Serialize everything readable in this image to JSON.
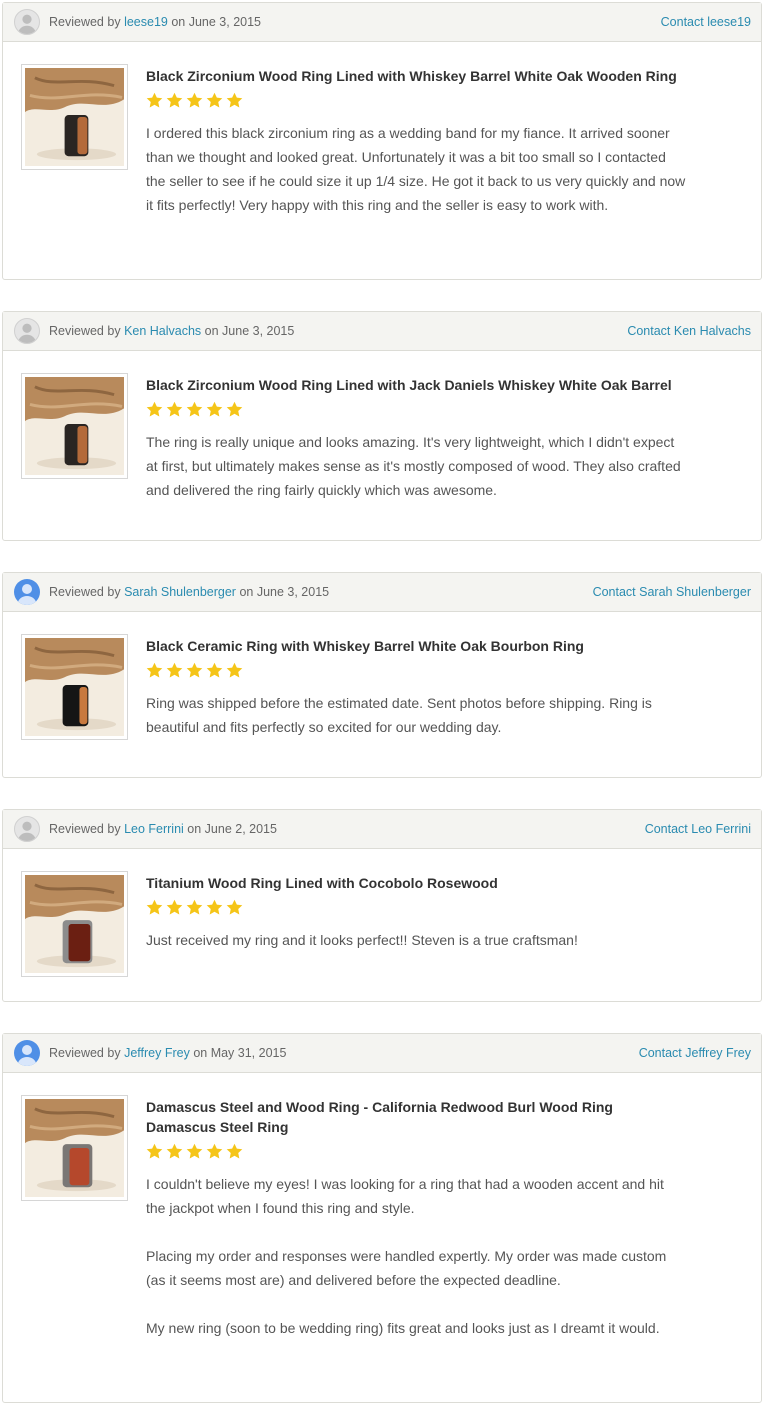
{
  "colors": {
    "link": "#2a8bb0",
    "star": "#f5c518",
    "header_bg": "#f4f4f1"
  },
  "reviews": [
    {
      "reviewed_by": "Reviewed by",
      "reviewer": "leese19",
      "on": "on June 3, 2015",
      "contact": "Contact leese19",
      "avatar": "gray-person-icon",
      "product": "Black Zirconium Wood Ring Lined with Whiskey Barrel White Oak Wooden Ring",
      "rating": 5,
      "text": [
        "I ordered this black zirconium ring as a wedding band for my fiance. It arrived sooner than we thought and looked great. Unfortunately it was a bit too small so I contacted the seller to see if he could size it up 1/4 size. He got it back to us very quickly and now it fits perfectly! Very happy with this ring and the seller is easy to work with."
      ]
    },
    {
      "reviewed_by": "Reviewed by",
      "reviewer": "Ken Halvachs",
      "on": "on June 3, 2015",
      "contact": "Contact Ken Halvachs",
      "avatar": "gray-person-icon",
      "product": "Black Zirconium Wood Ring Lined with Jack Daniels Whiskey White Oak Barrel",
      "rating": 5,
      "text": [
        "The ring is really unique and looks amazing. It's very lightweight, which I didn't expect at first, but ultimately makes sense as it's mostly composed of wood. They also crafted and delivered the ring fairly quickly which was awesome."
      ]
    },
    {
      "reviewed_by": "Reviewed by",
      "reviewer": "Sarah Shulenberger",
      "on": "on June 3, 2015",
      "contact": "Contact Sarah Shulenberger",
      "avatar": "blue-person-icon",
      "product": "Black Ceramic Ring with Whiskey Barrel White Oak Bourbon Ring",
      "rating": 5,
      "text": [
        "Ring was shipped before the estimated date. Sent photos before shipping. Ring is beautiful and fits perfectly so excited for our wedding day."
      ]
    },
    {
      "reviewed_by": "Reviewed by",
      "reviewer": "Leo Ferrini",
      "on": "on June 2, 2015",
      "contact": "Contact Leo Ferrini",
      "avatar": "gray-person-icon",
      "product": "Titanium Wood Ring Lined with Cocobolo Rosewood",
      "rating": 5,
      "text": [
        "Just received my ring and it looks perfect!! Steven is a true craftsman!"
      ]
    },
    {
      "reviewed_by": "Reviewed by",
      "reviewer": "Jeffrey Frey",
      "on": "on May 31, 2015",
      "contact": "Contact Jeffrey Frey",
      "avatar": "blue-person-icon",
      "product": "Damascus Steel and Wood Ring - California Redwood Burl Wood Ring Damascus Steel Ring",
      "rating": 5,
      "text": [
        "I couldn't believe my eyes! I was looking for a ring that had a wooden accent and hit the jackpot when I found this ring and style.",
        "Placing my order and responses were handled expertly. My order was made custom (as it seems most are) and delivered before the expected deadline.",
        "My new ring (soon to be wedding ring) fits great and looks just as I dreamt it would."
      ]
    }
  ]
}
